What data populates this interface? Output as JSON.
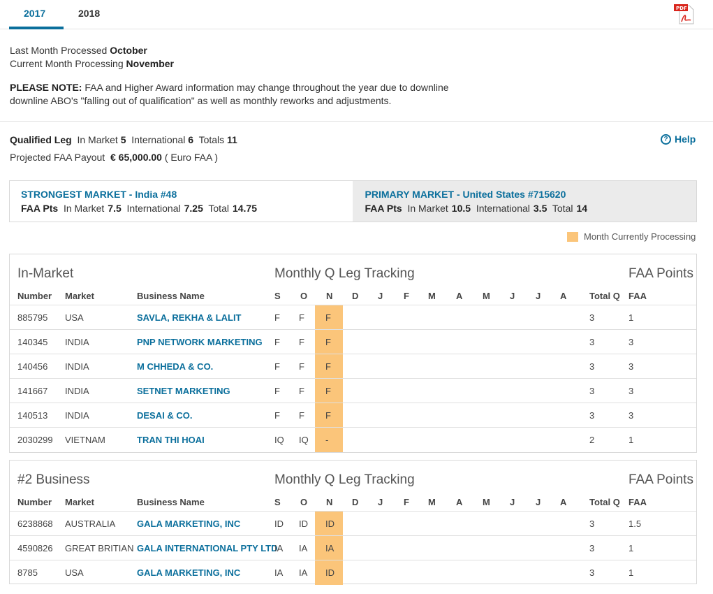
{
  "tabs": [
    "2017",
    "2018"
  ],
  "pdf_icon": "pdf-icon",
  "last_month_label": "Last Month Processed",
  "last_month_value": "October",
  "current_month_label": "Current Month Processing",
  "current_month_value": "November",
  "note_label": "PLEASE NOTE:",
  "note_line1": "FAA and Higher Award information may change throughout the year due to downline",
  "note_line2": "downline ABO's \"falling out of qualification\" as well as monthly reworks and adjustments.",
  "qualified_leg": {
    "label": "Qualified Leg",
    "in_market_label": "In Market",
    "in_market": "5",
    "international_label": "International",
    "international": "6",
    "totals_label": "Totals",
    "totals": "11"
  },
  "projected": {
    "label": "Projected FAA Payout",
    "value": "€ 65,000.00",
    "suffix": "( Euro FAA )"
  },
  "help_label": "Help",
  "strongest": {
    "title": "STRONGEST MARKET - India #48",
    "pts_label": "FAA Pts",
    "in_market_label": "In Market",
    "in_market": "7.5",
    "international_label": "International",
    "international": "7.25",
    "total_label": "Total",
    "total": "14.75"
  },
  "primary": {
    "title": "PRIMARY MARKET - United States #715620",
    "pts_label": "FAA Pts",
    "in_market_label": "In Market",
    "in_market": "10.5",
    "international_label": "International",
    "international": "3.5",
    "total_label": "Total",
    "total": "14"
  },
  "legend_label": "Month Currently Processing",
  "colors": {
    "accent": "#0b6f9c",
    "current_month": "#fbc57a"
  },
  "table_headers": {
    "number": "Number",
    "market": "Market",
    "business": "Business Name",
    "months": [
      "S",
      "O",
      "N",
      "D",
      "J",
      "F",
      "M",
      "A",
      "M",
      "J",
      "J",
      "A"
    ],
    "total_q": "Total Q",
    "faa": "FAA",
    "tracking_title": "Monthly Q Leg Tracking",
    "points_title": "FAA Points"
  },
  "in_market": {
    "title": "In-Market",
    "rows": [
      {
        "number": "885795",
        "market": "USA",
        "name": "SAVLA, REKHA & LALIT",
        "s": "F",
        "o": "F",
        "n": "F",
        "total_q": "3",
        "faa": "1"
      },
      {
        "number": "140345",
        "market": "INDIA",
        "name": "PNP NETWORK MARKETING",
        "s": "F",
        "o": "F",
        "n": "F",
        "total_q": "3",
        "faa": "3"
      },
      {
        "number": "140456",
        "market": "INDIA",
        "name": "M CHHEDA & CO.",
        "s": "F",
        "o": "F",
        "n": "F",
        "total_q": "3",
        "faa": "3"
      },
      {
        "number": "141667",
        "market": "INDIA",
        "name": "SETNET MARKETING",
        "s": "F",
        "o": "F",
        "n": "F",
        "total_q": "3",
        "faa": "3"
      },
      {
        "number": "140513",
        "market": "INDIA",
        "name": "DESAI & CO.",
        "s": "F",
        "o": "F",
        "n": "F",
        "total_q": "3",
        "faa": "3"
      },
      {
        "number": "2030299",
        "market": "VIETNAM",
        "name": "TRAN THI HOAI",
        "s": "IQ",
        "o": "IQ",
        "n": "-",
        "total_q": "2",
        "faa": "1"
      }
    ]
  },
  "second_business": {
    "title": "#2 Business",
    "rows": [
      {
        "number": "6238868",
        "market": "AUSTRALIA",
        "name": "GALA MARKETING, INC",
        "s": "ID",
        "o": "ID",
        "n": "ID",
        "total_q": "3",
        "faa": "1.5"
      },
      {
        "number": "4590826",
        "market": "GREAT BRITIAN",
        "name": "GALA INTERNATIONAL PTY LTD",
        "s": "IA",
        "o": "IA",
        "n": "IA",
        "total_q": "3",
        "faa": "1"
      },
      {
        "number": "8785",
        "market": "USA",
        "name": "GALA MARKETING, INC",
        "s": "IA",
        "o": "IA",
        "n": "ID",
        "total_q": "3",
        "faa": "1"
      }
    ]
  }
}
